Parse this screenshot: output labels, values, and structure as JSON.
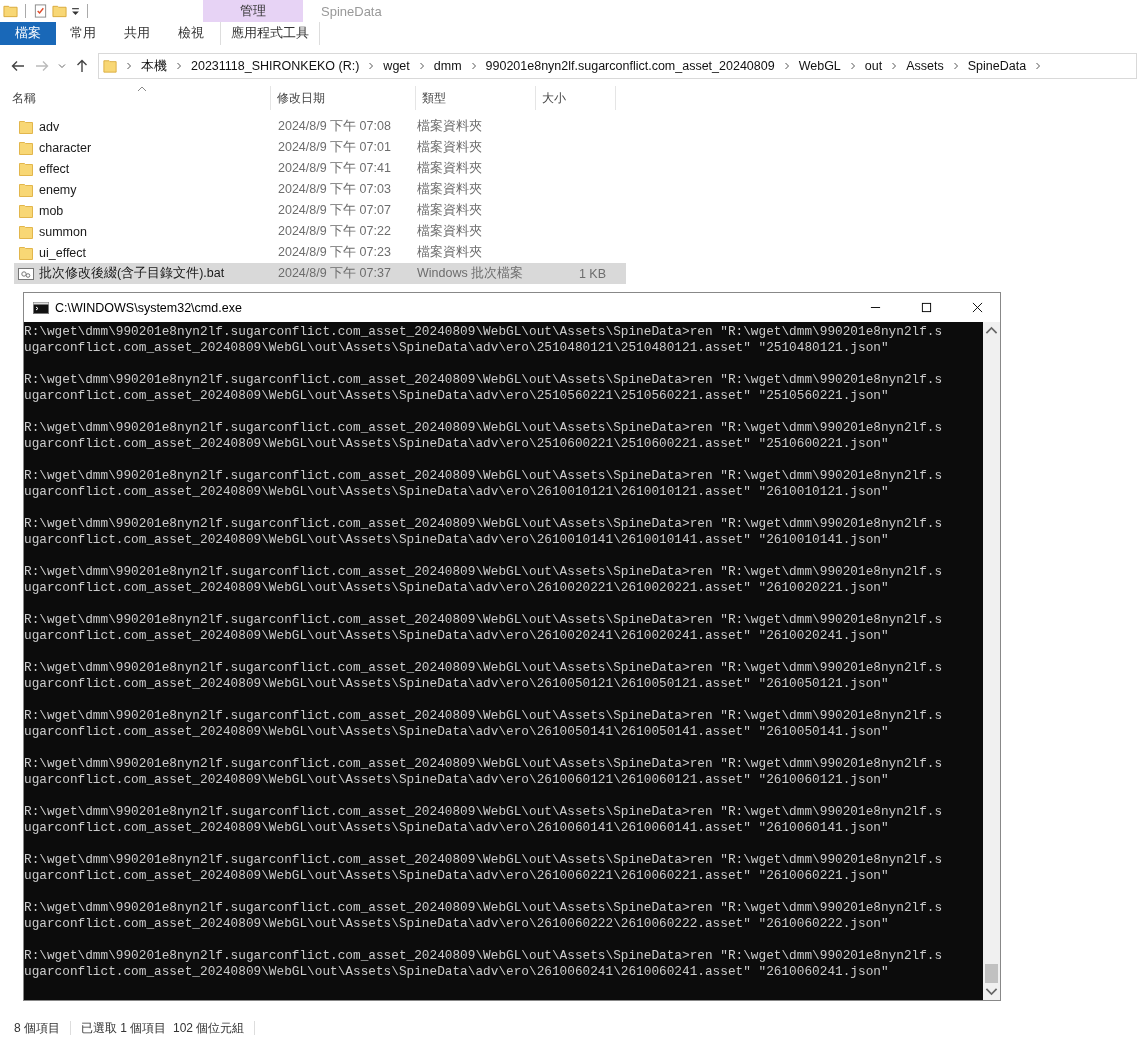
{
  "ribbon": {
    "contextual_group": "管理",
    "window_title": "SpineData",
    "tabs": [
      {
        "label": "檔案",
        "kind": "file",
        "selected": false
      },
      {
        "label": "常用",
        "kind": "tab",
        "selected": false
      },
      {
        "label": "共用",
        "kind": "tab",
        "selected": false
      },
      {
        "label": "檢視",
        "kind": "tab",
        "selected": false
      },
      {
        "label": "應用程式工具",
        "kind": "contextual",
        "selected": false
      }
    ]
  },
  "address_bar": {
    "path": [
      "本機",
      "20231118_SHIRONKEKO (R:)",
      "wget",
      "dmm",
      "990201e8nyn2lf.sugarconflict.com_asset_20240809",
      "WebGL",
      "out",
      "Assets",
      "SpineData"
    ]
  },
  "file_list": {
    "columns": [
      "名稱",
      "修改日期",
      "類型",
      "大小"
    ],
    "rows": [
      {
        "kind": "folder",
        "name": "adv",
        "modified": "2024/8/9 下午 07:08",
        "type": "檔案資料夾",
        "selected": false
      },
      {
        "kind": "folder",
        "name": "character",
        "modified": "2024/8/9 下午 07:01",
        "type": "檔案資料夾",
        "selected": false
      },
      {
        "kind": "folder",
        "name": "effect",
        "modified": "2024/8/9 下午 07:41",
        "type": "檔案資料夾",
        "selected": false
      },
      {
        "kind": "folder",
        "name": "enemy",
        "modified": "2024/8/9 下午 07:03",
        "type": "檔案資料夾",
        "selected": false
      },
      {
        "kind": "folder",
        "name": "mob",
        "modified": "2024/8/9 下午 07:07",
        "type": "檔案資料夾",
        "selected": false
      },
      {
        "kind": "folder",
        "name": "summon",
        "modified": "2024/8/9 下午 07:22",
        "type": "檔案資料夾",
        "selected": false
      },
      {
        "kind": "folder",
        "name": "ui_effect",
        "modified": "2024/8/9 下午 07:23",
        "type": "檔案資料夾",
        "selected": false
      },
      {
        "kind": "batch",
        "name": "批次修改後綴(含子目錄文件).bat",
        "modified": "2024/8/9 下午 07:37",
        "type": "Windows 批次檔案",
        "size": "1 KB",
        "selected": true
      }
    ]
  },
  "status_bar": {
    "item_count": "8 個項目",
    "selection": "已選取 1 個項目  102 個位元組"
  },
  "console": {
    "title": "C:\\WINDOWS\\system32\\cmd.exe",
    "entries": [
      {
        "lines": [
          "R:\\wget\\dmm\\990201e8nyn2lf.sugarconflict.com_asset_20240809\\WebGL\\out\\Assets\\SpineData>ren \"R:\\wget\\dmm\\990201e8nyn2lf.s",
          "ugarconflict.com_asset_20240809\\WebGL\\out\\Assets\\SpineData\\adv\\ero\\2510480121\\2510480121.asset\" \"2510480121.json\""
        ]
      },
      {
        "lines": [
          "R:\\wget\\dmm\\990201e8nyn2lf.sugarconflict.com_asset_20240809\\WebGL\\out\\Assets\\SpineData>ren \"R:\\wget\\dmm\\990201e8nyn2lf.s",
          "ugarconflict.com_asset_20240809\\WebGL\\out\\Assets\\SpineData\\adv\\ero\\2510560221\\2510560221.asset\" \"2510560221.json\""
        ]
      },
      {
        "lines": [
          "R:\\wget\\dmm\\990201e8nyn2lf.sugarconflict.com_asset_20240809\\WebGL\\out\\Assets\\SpineData>ren \"R:\\wget\\dmm\\990201e8nyn2lf.s",
          "ugarconflict.com_asset_20240809\\WebGL\\out\\Assets\\SpineData\\adv\\ero\\2510600221\\2510600221.asset\" \"2510600221.json\""
        ]
      },
      {
        "lines": [
          "R:\\wget\\dmm\\990201e8nyn2lf.sugarconflict.com_asset_20240809\\WebGL\\out\\Assets\\SpineData>ren \"R:\\wget\\dmm\\990201e8nyn2lf.s",
          "ugarconflict.com_asset_20240809\\WebGL\\out\\Assets\\SpineData\\adv\\ero\\2610010121\\2610010121.asset\" \"2610010121.json\""
        ]
      },
      {
        "lines": [
          "R:\\wget\\dmm\\990201e8nyn2lf.sugarconflict.com_asset_20240809\\WebGL\\out\\Assets\\SpineData>ren \"R:\\wget\\dmm\\990201e8nyn2lf.s",
          "ugarconflict.com_asset_20240809\\WebGL\\out\\Assets\\SpineData\\adv\\ero\\2610010141\\2610010141.asset\" \"2610010141.json\""
        ]
      },
      {
        "lines": [
          "R:\\wget\\dmm\\990201e8nyn2lf.sugarconflict.com_asset_20240809\\WebGL\\out\\Assets\\SpineData>ren \"R:\\wget\\dmm\\990201e8nyn2lf.s",
          "ugarconflict.com_asset_20240809\\WebGL\\out\\Assets\\SpineData\\adv\\ero\\2610020221\\2610020221.asset\" \"2610020221.json\""
        ]
      },
      {
        "lines": [
          "R:\\wget\\dmm\\990201e8nyn2lf.sugarconflict.com_asset_20240809\\WebGL\\out\\Assets\\SpineData>ren \"R:\\wget\\dmm\\990201e8nyn2lf.s",
          "ugarconflict.com_asset_20240809\\WebGL\\out\\Assets\\SpineData\\adv\\ero\\2610020241\\2610020241.asset\" \"2610020241.json\""
        ]
      },
      {
        "lines": [
          "R:\\wget\\dmm\\990201e8nyn2lf.sugarconflict.com_asset_20240809\\WebGL\\out\\Assets\\SpineData>ren \"R:\\wget\\dmm\\990201e8nyn2lf.s",
          "ugarconflict.com_asset_20240809\\WebGL\\out\\Assets\\SpineData\\adv\\ero\\2610050121\\2610050121.asset\" \"2610050121.json\""
        ]
      },
      {
        "lines": [
          "R:\\wget\\dmm\\990201e8nyn2lf.sugarconflict.com_asset_20240809\\WebGL\\out\\Assets\\SpineData>ren \"R:\\wget\\dmm\\990201e8nyn2lf.s",
          "ugarconflict.com_asset_20240809\\WebGL\\out\\Assets\\SpineData\\adv\\ero\\2610050141\\2610050141.asset\" \"2610050141.json\""
        ]
      },
      {
        "lines": [
          "R:\\wget\\dmm\\990201e8nyn2lf.sugarconflict.com_asset_20240809\\WebGL\\out\\Assets\\SpineData>ren \"R:\\wget\\dmm\\990201e8nyn2lf.s",
          "ugarconflict.com_asset_20240809\\WebGL\\out\\Assets\\SpineData\\adv\\ero\\2610060121\\2610060121.asset\" \"2610060121.json\""
        ]
      },
      {
        "lines": [
          "R:\\wget\\dmm\\990201e8nyn2lf.sugarconflict.com_asset_20240809\\WebGL\\out\\Assets\\SpineData>ren \"R:\\wget\\dmm\\990201e8nyn2lf.s",
          "ugarconflict.com_asset_20240809\\WebGL\\out\\Assets\\SpineData\\adv\\ero\\2610060141\\2610060141.asset\" \"2610060141.json\""
        ]
      },
      {
        "lines": [
          "R:\\wget\\dmm\\990201e8nyn2lf.sugarconflict.com_asset_20240809\\WebGL\\out\\Assets\\SpineData>ren \"R:\\wget\\dmm\\990201e8nyn2lf.s",
          "ugarconflict.com_asset_20240809\\WebGL\\out\\Assets\\SpineData\\adv\\ero\\2610060221\\2610060221.asset\" \"2610060221.json\""
        ]
      },
      {
        "lines": [
          "R:\\wget\\dmm\\990201e8nyn2lf.sugarconflict.com_asset_20240809\\WebGL\\out\\Assets\\SpineData>ren \"R:\\wget\\dmm\\990201e8nyn2lf.s",
          "ugarconflict.com_asset_20240809\\WebGL\\out\\Assets\\SpineData\\adv\\ero\\2610060222\\2610060222.asset\" \"2610060222.json\""
        ]
      },
      {
        "lines": [
          "R:\\wget\\dmm\\990201e8nyn2lf.sugarconflict.com_asset_20240809\\WebGL\\out\\Assets\\SpineData>ren \"R:\\wget\\dmm\\990201e8nyn2lf.s",
          "ugarconflict.com_asset_20240809\\WebGL\\out\\Assets\\SpineData\\adv\\ero\\2610060241\\2610060241.asset\" \"2610060241.json\""
        ]
      }
    ]
  }
}
